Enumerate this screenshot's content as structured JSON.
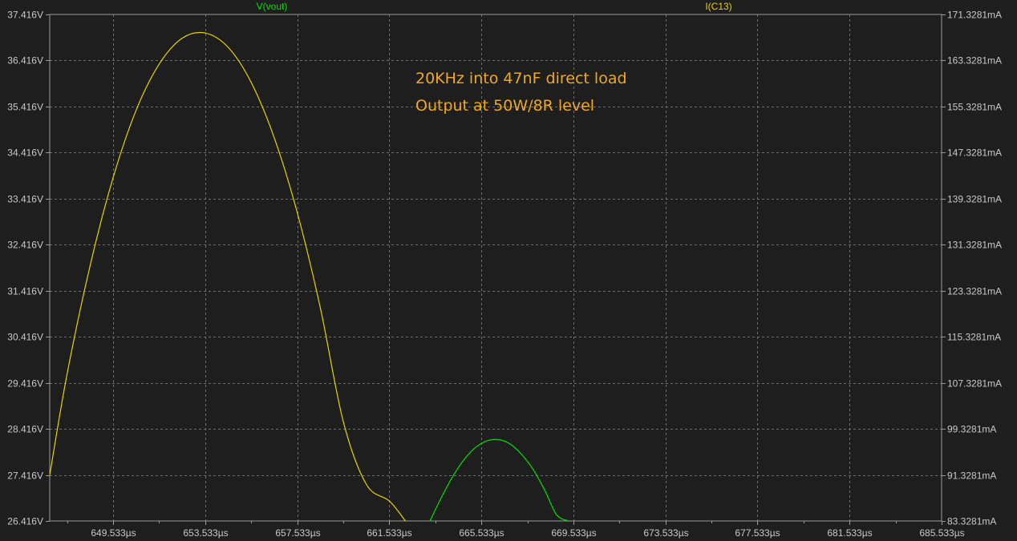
{
  "colors": {
    "background": "#1e1e1e",
    "frame": "#9a9a9a",
    "grid": "#6e6e6e",
    "tick_text": "#c8c8c8",
    "trace_vout": "#00e000",
    "trace_ic13": "#e6d200",
    "annotation": "#f0a820"
  },
  "chart_data": {
    "type": "line",
    "x_unit": "µs",
    "xlim": [
      646.777,
      685.533
    ],
    "x_ticks": [
      {
        "value": 649.533,
        "label": "649.533µs"
      },
      {
        "value": 653.533,
        "label": "653.533µs"
      },
      {
        "value": 657.533,
        "label": "657.533µs"
      },
      {
        "value": 661.533,
        "label": "661.533µs"
      },
      {
        "value": 665.533,
        "label": "665.533µs"
      },
      {
        "value": 669.533,
        "label": "669.533µs"
      },
      {
        "value": 673.533,
        "label": "673.533µs"
      },
      {
        "value": 677.533,
        "label": "677.533µs"
      },
      {
        "value": 681.533,
        "label": "681.533µs"
      },
      {
        "value": 685.533,
        "label": "685.533µs"
      }
    ],
    "left_axis": {
      "unit": "V",
      "ylim": [
        26.416,
        37.416
      ],
      "ticks": [
        {
          "value": 37.416,
          "label": "37.416V"
        },
        {
          "value": 36.416,
          "label": "36.416V"
        },
        {
          "value": 35.416,
          "label": "35.416V"
        },
        {
          "value": 34.416,
          "label": "34.416V"
        },
        {
          "value": 33.416,
          "label": "33.416V"
        },
        {
          "value": 32.416,
          "label": "32.416V"
        },
        {
          "value": 31.416,
          "label": "31.416V"
        },
        {
          "value": 30.416,
          "label": "30.416V"
        },
        {
          "value": 29.416,
          "label": "29.416V"
        },
        {
          "value": 28.416,
          "label": "28.416V"
        },
        {
          "value": 27.416,
          "label": "27.416V"
        },
        {
          "value": 26.416,
          "label": "26.416V"
        }
      ]
    },
    "right_axis": {
      "unit": "mA",
      "ylim": [
        83.3281,
        171.3281
      ],
      "ticks": [
        {
          "value": 171.3281,
          "label": "171.3281mA"
        },
        {
          "value": 163.3281,
          "label": "163.3281mA"
        },
        {
          "value": 155.3281,
          "label": "155.3281mA"
        },
        {
          "value": 147.3281,
          "label": "147.3281mA"
        },
        {
          "value": 139.3281,
          "label": "139.3281mA"
        },
        {
          "value": 131.3281,
          "label": "131.3281mA"
        },
        {
          "value": 123.3281,
          "label": "123.3281mA"
        },
        {
          "value": 115.3281,
          "label": "115.3281mA"
        },
        {
          "value": 107.3281,
          "label": "107.3281mA"
        },
        {
          "value": 99.3281,
          "label": "99.3281mA"
        },
        {
          "value": 91.3281,
          "label": "91.3281mA"
        },
        {
          "value": 83.3281,
          "label": "83.3281mA"
        }
      ]
    },
    "grid": true,
    "series": [
      {
        "name": "V(vout)",
        "axis": "left",
        "color": "#00e000",
        "x": [
          663.3,
          663.8,
          664.3,
          664.8,
          665.3,
          665.8,
          666.3,
          666.8,
          667.3,
          667.8,
          668.3,
          668.8,
          669.3
        ],
        "y": [
          26.416,
          26.93,
          27.39,
          27.76,
          28.02,
          28.16,
          28.18,
          28.08,
          27.85,
          27.52,
          27.07,
          26.55,
          26.416
        ]
      },
      {
        "name": "I(C13)",
        "axis": "right",
        "color": "#e6d200",
        "x": [
          646.777,
          647.533,
          648.533,
          649.533,
          650.533,
          651.533,
          652.533,
          653.533,
          654.533,
          655.533,
          656.533,
          657.533,
          658.533,
          659.533,
          660.533,
          661.533,
          662.233
        ],
        "y": [
          91.3,
          108.9,
          127.7,
          143.0,
          154.7,
          162.7,
          167.2,
          168.1,
          165.6,
          159.5,
          149.9,
          136.9,
          120.4,
          100.6,
          89.7,
          86.8,
          83.3281
        ]
      }
    ],
    "annotations": [
      "20KHz into 47nF direct load",
      "Output at 50W/8R level"
    ]
  }
}
